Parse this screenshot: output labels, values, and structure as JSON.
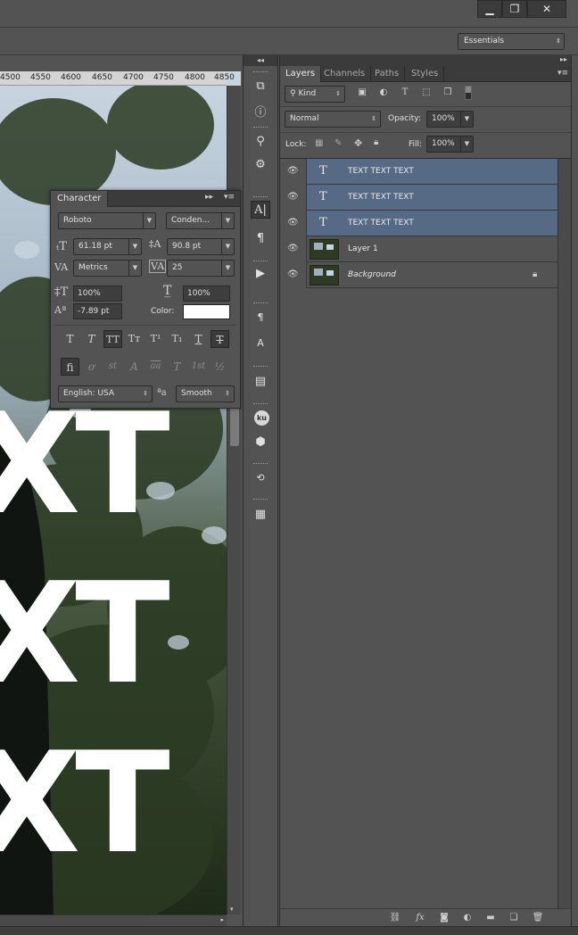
{
  "window": {
    "minimize": "▁",
    "restore": "❐",
    "close": "✕"
  },
  "optionsbar": {
    "workspace": "Essentials"
  },
  "ruler": {
    "ticks": [
      "4500",
      "4550",
      "4600",
      "4650",
      "4700",
      "4750",
      "4800",
      "4850"
    ]
  },
  "canvas": {
    "text_lines": [
      "XT",
      "XT",
      "XT"
    ]
  },
  "character": {
    "title": "Character",
    "font_family": "Roboto",
    "font_style": "Conden...",
    "font_size": "61.18 pt",
    "leading": "90.8 pt",
    "kerning": "Metrics",
    "tracking": "25",
    "vertical_scale": "100%",
    "horizontal_scale": "100%",
    "baseline_shift": "-7.89 pt",
    "color_label": "Color:",
    "color_value": "#ffffff",
    "language": "English: USA",
    "antialias_icon": "ªa",
    "antialias": "Smooth",
    "style_buttons": [
      "T",
      "T",
      "TT",
      "Tт",
      "T¹",
      "T₁",
      "T",
      "T"
    ],
    "opentype_buttons": [
      "ﬁ",
      "ơ",
      "st",
      "A",
      "aa",
      "T",
      "1st",
      "½"
    ]
  },
  "layers": {
    "tabs": [
      "Layers",
      "Channels",
      "Paths",
      "Styles"
    ],
    "filter_kind": "Kind",
    "blend_mode": "Normal",
    "opacity_label": "Opacity:",
    "opacity": "100%",
    "lock_label": "Lock:",
    "fill_label": "Fill:",
    "fill": "100%",
    "items": [
      {
        "name": "TEXT TEXT TEXT",
        "type": "text",
        "selected": true
      },
      {
        "name": "TEXT TEXT TEXT",
        "type": "text",
        "selected": true
      },
      {
        "name": "TEXT TEXT TEXT",
        "type": "text",
        "selected": true
      },
      {
        "name": "Layer 1",
        "type": "image",
        "selected": false
      },
      {
        "name": "Background",
        "type": "image",
        "selected": false,
        "locked": true
      }
    ]
  },
  "colors": {
    "selection": "#566a86",
    "panel": "#535353",
    "dark": "#3b3b3b"
  }
}
